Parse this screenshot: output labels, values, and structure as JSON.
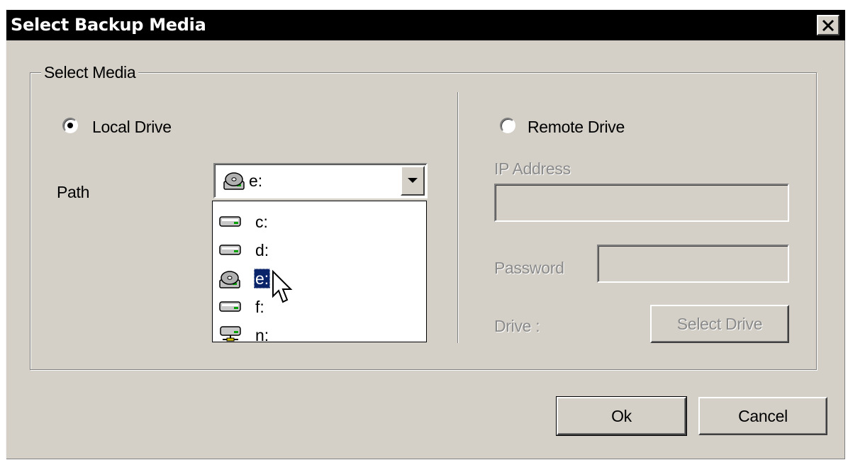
{
  "window": {
    "title": "Select Backup Media",
    "close_glyph": "✕"
  },
  "group": {
    "legend": "Select Media"
  },
  "local": {
    "radio_label": "Local Drive",
    "path_label": "Path",
    "selected_drive": "e:"
  },
  "drives": [
    {
      "letter": "c:",
      "icon": "hard-drive-icon"
    },
    {
      "letter": "d:",
      "icon": "hard-drive-icon"
    },
    {
      "letter": "e:",
      "icon": "cd-drive-icon",
      "selected": true
    },
    {
      "letter": "f:",
      "icon": "hard-drive-icon"
    },
    {
      "letter": "n:",
      "icon": "network-drive-icon"
    }
  ],
  "remote": {
    "radio_label": "Remote Drive",
    "ip_label": "IP Address",
    "password_label": "Password",
    "drive_label": "Drive :",
    "select_drive_button": "Select Drive"
  },
  "buttons": {
    "ok": "Ok",
    "cancel": "Cancel"
  },
  "colors": {
    "face": "#d4d0c8",
    "selection": "#0a246a",
    "title_bar": "#000000"
  }
}
